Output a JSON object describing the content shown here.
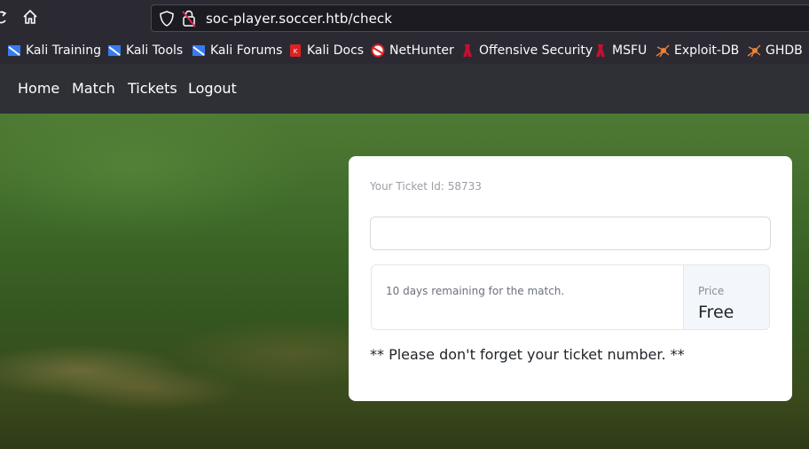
{
  "browser": {
    "url": "soc-player.soccer.htb/check",
    "bookmarks": [
      {
        "label": "Kali Training",
        "icon": "kali-dragon-icon"
      },
      {
        "label": "Kali Tools",
        "icon": "kali-dragon-icon"
      },
      {
        "label": "Kali Forums",
        "icon": "kali-dragon-icon"
      },
      {
        "label": "Kali Docs",
        "icon": "kali-docs-icon"
      },
      {
        "label": "NetHunter",
        "icon": "nethunter-icon"
      },
      {
        "label": "Offensive Security",
        "icon": "offsec-icon"
      },
      {
        "label": "MSFU",
        "icon": "offsec-icon"
      },
      {
        "label": "Exploit-DB",
        "icon": "exploitdb-spider-icon"
      },
      {
        "label": "GHDB",
        "icon": "exploitdb-spider-icon"
      }
    ]
  },
  "nav": {
    "links": [
      "Home",
      "Match",
      "Tickets",
      "Logout"
    ]
  },
  "ticket": {
    "id_text": "Your Ticket Id: 58733",
    "input_value": "",
    "remaining": "10 days remaining for the match.",
    "price_label": "Price",
    "price_value": "Free",
    "reminder": "** Please don't forget your ticket number. **"
  },
  "colors": {
    "chrome_bg": "#2b2a33",
    "nav_bg": "#2e3036",
    "card_bg": "#ffffff",
    "grass": "#3f6a2a"
  }
}
